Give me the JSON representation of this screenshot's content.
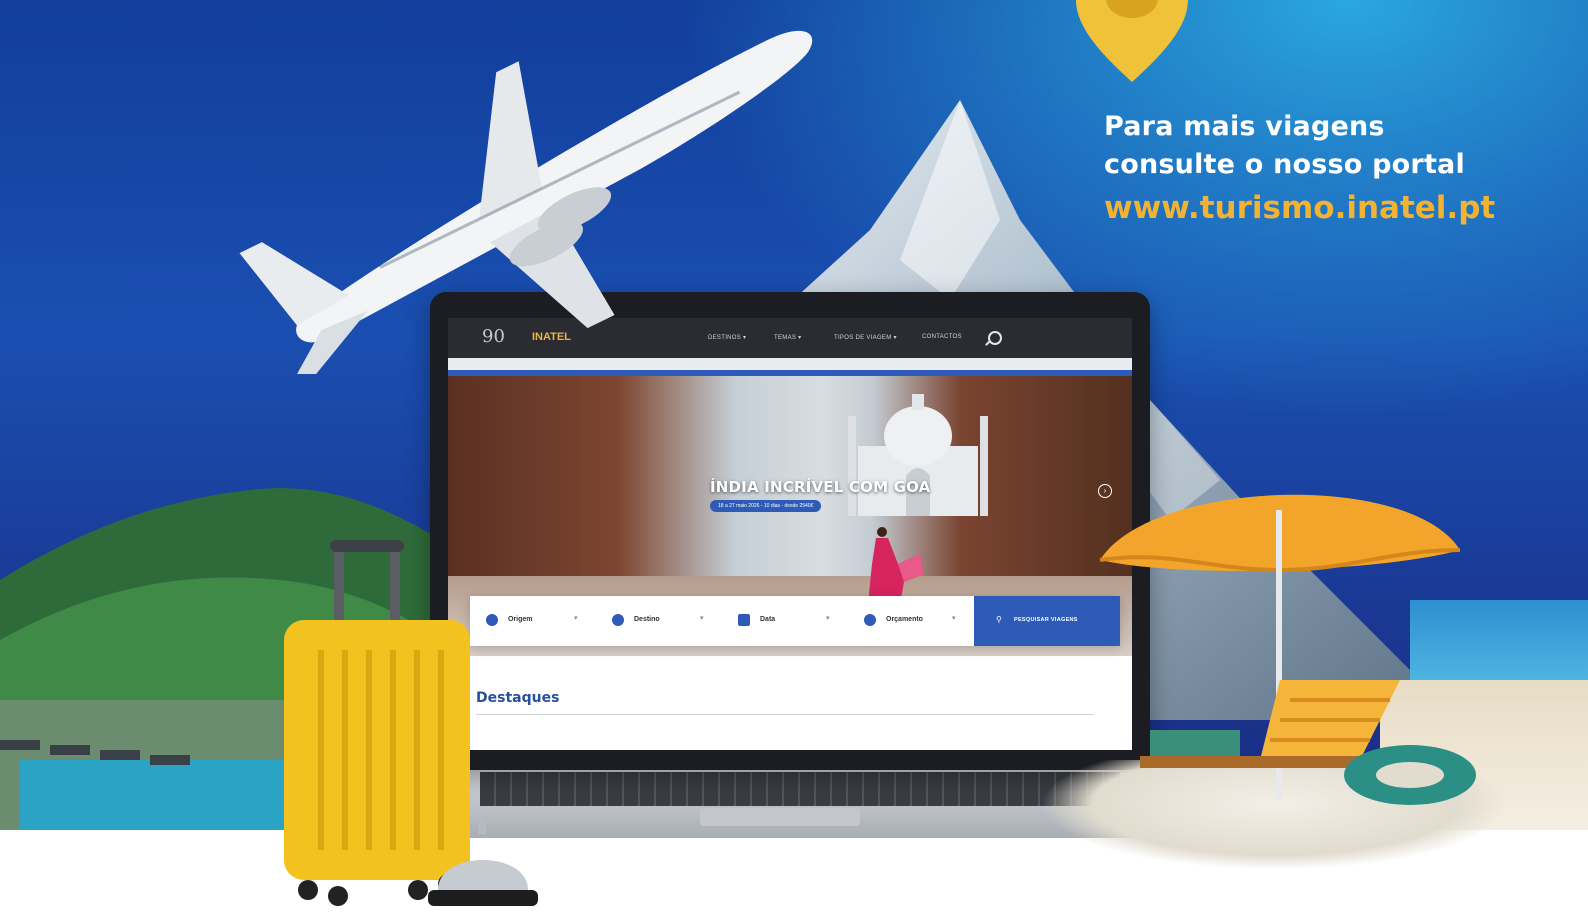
{
  "promo": {
    "line1": "Para mais viagens",
    "line2": "consulte o nosso portal",
    "url": "www.turismo.inatel.pt"
  },
  "website": {
    "logo_mark": "90",
    "brand": "INATEL",
    "nav": [
      {
        "label": "DESTINOS ▾"
      },
      {
        "label": "TEMAS ▾"
      },
      {
        "label": "TIPOS DE VIAGEM ▾"
      },
      {
        "label": "CONTACTOS"
      }
    ],
    "hero": {
      "title": "ÍNDIA INCRÍVEL COM GOA",
      "subtitle": "18 a 27 maio 2026 - 10 dias - desde 2540€"
    },
    "search": {
      "fields": [
        {
          "label": "Origem",
          "icon": "list-icon"
        },
        {
          "label": "Destino",
          "icon": "globe-icon"
        },
        {
          "label": "Data",
          "icon": "calendar-icon"
        },
        {
          "label": "Orçamento",
          "icon": "euro-icon"
        }
      ],
      "button_label": "PESQUISAR VIAGENS"
    },
    "section_title": "Destaques"
  },
  "colors": {
    "accent": "#2e5bb8",
    "promo_url": "#f2b233",
    "sky": "#1a4fb1"
  }
}
